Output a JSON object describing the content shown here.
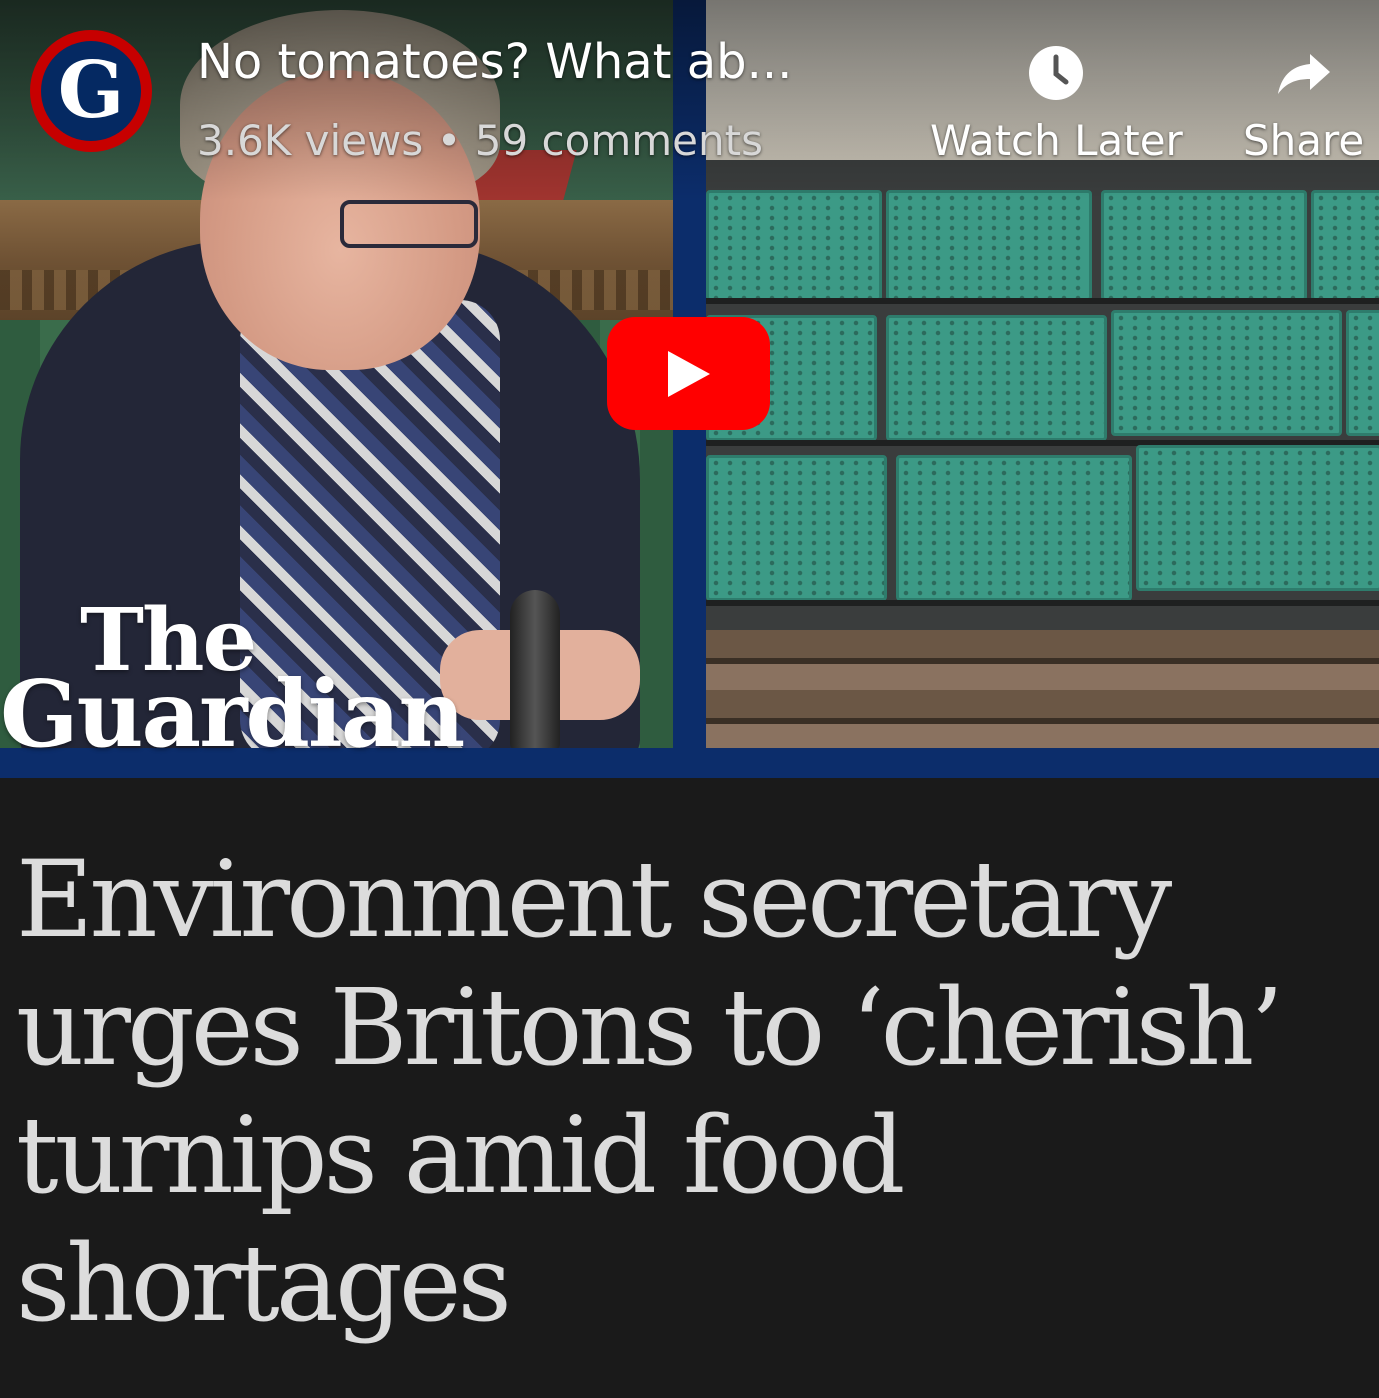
{
  "video": {
    "channel_logo_letter": "G",
    "title": "No tomatoes? What ab...",
    "meta": "3.6K views • 59 comments",
    "actions": {
      "watch_later": "Watch Later",
      "share": "Share"
    },
    "play_icon": "play-icon",
    "watermark": {
      "line1": "The",
      "line2": "Guardian"
    }
  },
  "article": {
    "headline": "Environment secretary urges Britons to ‘cherish’ turnips amid food shortages"
  },
  "colors": {
    "page_background": "#1a1a1a",
    "guardian_blue": "#052962",
    "guardian_red": "#c70000",
    "youtube_red": "#ff0000",
    "headline_text": "#dcdcdc"
  }
}
